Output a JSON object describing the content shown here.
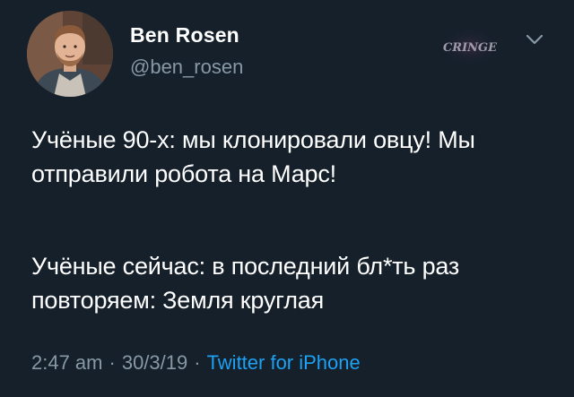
{
  "author": {
    "name": "Ben Rosen",
    "handle": "@ben_rosen",
    "avatar_icon": "profile-photo"
  },
  "watermark": {
    "text": "CRINGE"
  },
  "menu": {
    "icon": "chevron-down-icon"
  },
  "tweet": {
    "paragraphs": [
      "Учёные 90-х: мы клонировали овцу! Мы отправили робота на Марс!",
      "Учёные сейчас: в последний бл*ть раз повторяем: Земля круглая"
    ]
  },
  "meta": {
    "time": "2:47 am",
    "separator": "·",
    "date": "30/3/19",
    "source": "Twitter for iPhone"
  },
  "colors": {
    "background": "#15202b",
    "text": "#ffffff",
    "muted": "#8899a6",
    "link": "#1da1f2"
  }
}
